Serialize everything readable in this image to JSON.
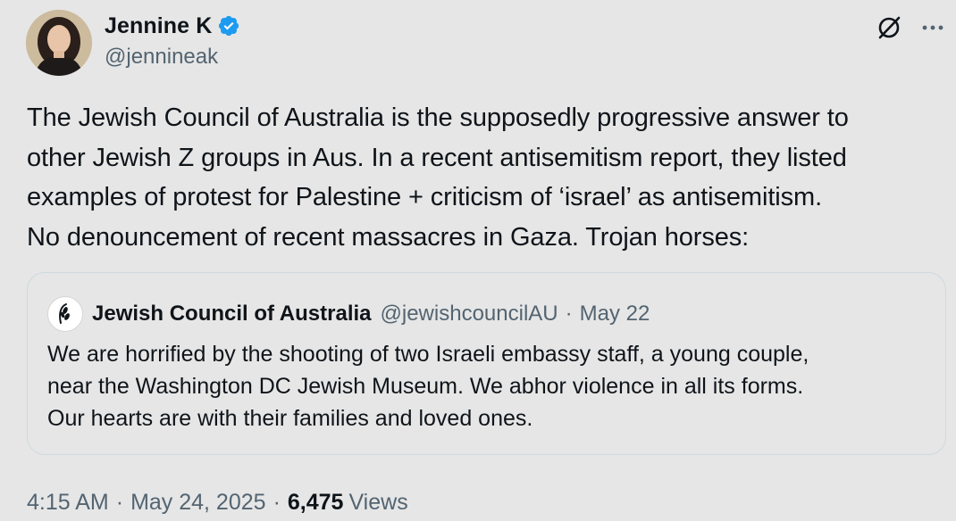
{
  "tweet": {
    "author": {
      "name": "Jennine K",
      "handle": "@jennineak",
      "verified_color": "#1d9bf0"
    },
    "text_lines": [
      "The Jewish Council of Australia is the supposedly progressive answer to",
      "other Jewish Z groups in Aus. In a recent antisemitism report, they listed",
      "examples of protest for Palestine + criticism of ‘israel’ as antisemitism.",
      "No denouncement of recent massacres in Gaza. Trojan horses:"
    ],
    "quote": {
      "name": "Jewish Council of Australia",
      "handle": "@jewishcouncilAU",
      "separator": "·",
      "date": "May 22",
      "text_lines": [
        "We are horrified by the shooting of two Israeli embassy staff, a young couple,",
        "near the Washington DC Jewish Museum. We abhor violence in all its forms.",
        "Our hearts are with their families and loved ones."
      ]
    },
    "meta": {
      "time": "4:15 AM",
      "separator": "·",
      "date": "May 24, 2025",
      "views_count": "6,475",
      "views_label": "Views"
    }
  },
  "icons": {
    "grok": "grok-icon",
    "more": "more-icon",
    "verified": "verified-badge-icon"
  },
  "colors": {
    "background": "#e6e6e6",
    "text_primary": "#0f1419",
    "text_secondary": "#536471",
    "border": "#cfd9de",
    "accent": "#1d9bf0"
  }
}
